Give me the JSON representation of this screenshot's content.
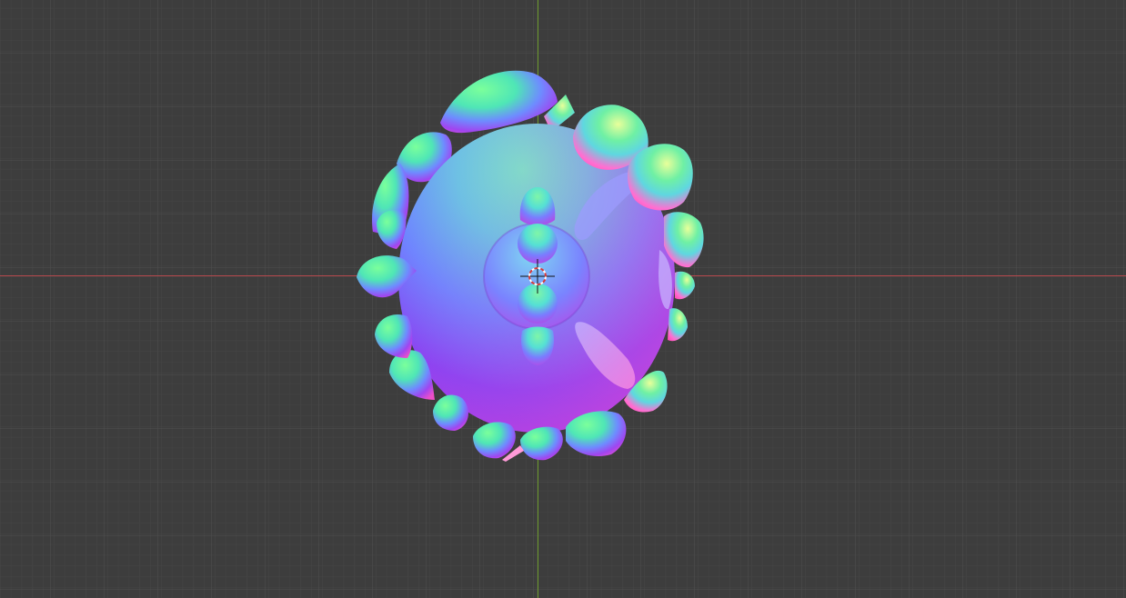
{
  "viewport": {
    "background_color": "#3d3d3d",
    "grid_minor_color": "#474747",
    "grid_major_color": "#545454",
    "axis_x_color": "#b8494d",
    "axis_y_color": "#6d9a2d",
    "cursor_icon": "3d-cursor-icon",
    "mesh_shading": "normal-map",
    "mesh_colors": {
      "cyan": "#5cf0d8",
      "green": "#6fe89a",
      "blue": "#6a78ff",
      "violet": "#8a3cf0",
      "magenta": "#e23ec8",
      "pink": "#ff7ad8"
    }
  }
}
